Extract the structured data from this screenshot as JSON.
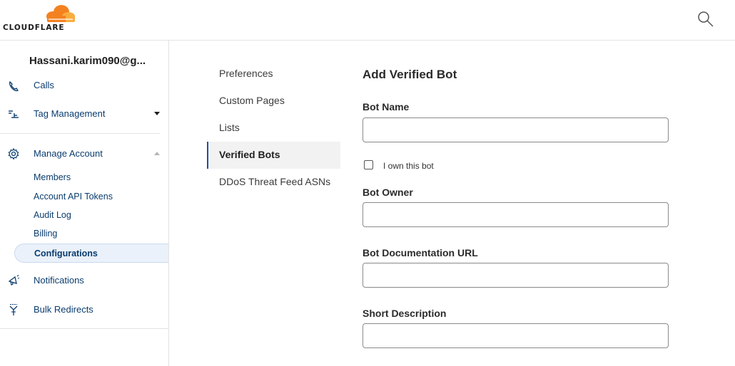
{
  "brand": {
    "name": "CLOUDFLARE",
    "colors": {
      "orange": "#f48120",
      "light_orange": "#faad3f",
      "link_blue": "#0a3c6e",
      "active_bar": "#1e4fa3"
    }
  },
  "header": {
    "search_icon": "search-icon"
  },
  "sidebar": {
    "account_name": "Hassani.karim090@g...",
    "items": [
      {
        "label": "Calls",
        "icon": "phone-icon"
      },
      {
        "label": "Tag Management",
        "icon": "tag-management-icon",
        "expanded": false
      },
      {
        "label": "Manage Account",
        "icon": "gear-icon",
        "expanded": true
      },
      {
        "label": "Notifications",
        "icon": "megaphone-icon"
      },
      {
        "label": "Bulk Redirects",
        "icon": "redirect-icon"
      }
    ],
    "manage_account_sub": [
      {
        "label": "Members"
      },
      {
        "label": "Account API Tokens"
      },
      {
        "label": "Audit Log"
      },
      {
        "label": "Billing"
      },
      {
        "label": "Configurations",
        "active": true
      }
    ]
  },
  "subnav": {
    "items": [
      {
        "label": "Preferences"
      },
      {
        "label": "Custom Pages"
      },
      {
        "label": "Lists"
      },
      {
        "label": "Verified Bots",
        "active": true
      },
      {
        "label": "DDoS Threat Feed ASNs"
      }
    ]
  },
  "form": {
    "title": "Add Verified Bot",
    "bot_name": {
      "label": "Bot Name",
      "value": ""
    },
    "own_bot": {
      "label": "I own this bot",
      "checked": false
    },
    "bot_owner": {
      "label": "Bot Owner",
      "value": ""
    },
    "doc_url": {
      "label": "Bot Documentation URL",
      "value": ""
    },
    "short_description": {
      "label": "Short Description",
      "value": ""
    }
  }
}
